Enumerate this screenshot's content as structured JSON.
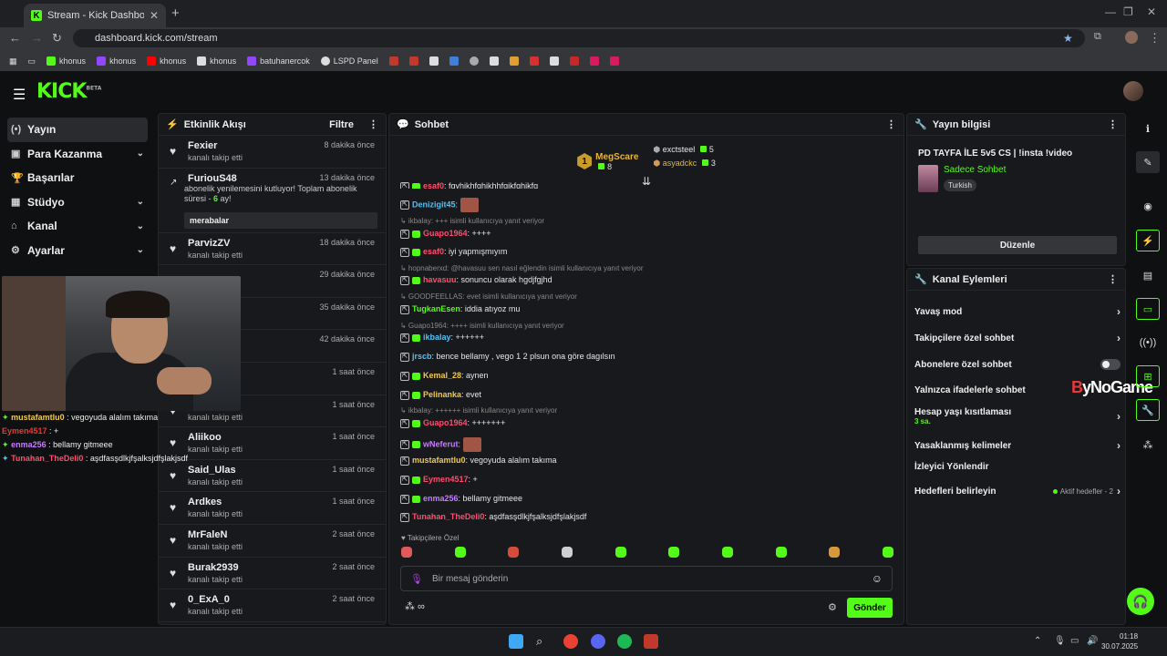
{
  "browser": {
    "tab_title": "Stream - Kick Dashboard",
    "url": "dashboard.kick.com/stream",
    "bookmarks": [
      {
        "label": "khonus",
        "color": "#53fc18"
      },
      {
        "label": "khonus",
        "color": "#9146ff"
      },
      {
        "label": "khonus",
        "color": "#ff0000"
      },
      {
        "label": "khonus",
        "color": "#dddddd"
      },
      {
        "label": "batuhanercok",
        "color": "#9146ff"
      },
      {
        "label": "LSPD Panel",
        "color": "#dddddd"
      }
    ]
  },
  "header": {
    "logo": "KICK",
    "logo_tag": "BETA"
  },
  "sidebar": {
    "items": [
      {
        "icon": "stream-icon",
        "glyph": "(•)",
        "label": "Yayın",
        "chevron": false
      },
      {
        "icon": "money-icon",
        "glyph": "▣",
        "label": "Para Kazanma",
        "chevron": true
      },
      {
        "icon": "trophy-icon",
        "glyph": "🏆",
        "label": "Başarılar",
        "chevron": false
      },
      {
        "icon": "studio-icon",
        "glyph": "▦",
        "label": "Stüdyo",
        "chevron": true
      },
      {
        "icon": "channel-icon",
        "glyph": "⌂",
        "label": "Kanal",
        "chevron": true
      },
      {
        "icon": "settings-icon",
        "glyph": "⚙",
        "label": "Ayarlar",
        "chevron": true
      }
    ]
  },
  "events": {
    "title": "Etkinlik Akışı",
    "filter_label": "Filtre",
    "items": [
      {
        "name": "Fexier",
        "sub": "kanalı takip etti",
        "time": "8 dakika önce"
      },
      {
        "name": "FuriouS48",
        "sub": "",
        "time": "13 dakika önce"
      },
      {
        "name": "ParvizZV",
        "sub": "kanalı takip etti",
        "time": "18 dakika önce"
      },
      {
        "name": "",
        "sub": "",
        "time": "29 dakika önce"
      },
      {
        "name": "",
        "sub": "",
        "time": "35 dakika önce"
      },
      {
        "name": "",
        "sub": "",
        "time": "42 dakika önce"
      },
      {
        "name": "",
        "sub": "",
        "time": "1 saat önce"
      },
      {
        "name": "azrakkn",
        "sub": "kanalı takip etti",
        "time": "1 saat önce"
      },
      {
        "name": "Aliikoo",
        "sub": "kanalı takip etti",
        "time": "1 saat önce"
      },
      {
        "name": "Said_Ulas",
        "sub": "kanalı takip etti",
        "time": "1 saat önce"
      },
      {
        "name": "Ardkes",
        "sub": "kanalı takip etti",
        "time": "1 saat önce"
      },
      {
        "name": "MrFaleN",
        "sub": "kanalı takip etti",
        "time": "2 saat önce"
      },
      {
        "name": "Burak2939",
        "sub": "kanalı takip etti",
        "time": "2 saat önce"
      },
      {
        "name": "0_ExA_0",
        "sub": "kanalı takip etti",
        "time": "2 saat önce"
      }
    ],
    "sub_message_a": "abonelik yenilemesini kutluyor! Toplam abonelik süresi - ",
    "sub_months": "6",
    "sub_message_b": " ay!",
    "sub_note": "merabalar"
  },
  "overlay_chat": [
    {
      "user": "mustafamtlu0",
      "text": " : vegoyuda alalım takıma",
      "color": "#f2c94c",
      "badge": "#53fc18"
    },
    {
      "user": "Eymen4517",
      "text": " : +",
      "color": "#e53935",
      "badge": ""
    },
    {
      "user": "enma256",
      "text": " : bellamy gitmeee",
      "color": "#c77dff",
      "badge": "#53fc18"
    },
    {
      "user": "Tunahan_TheDeli0",
      "text": " : aşdfasşdlkjfşalksjdfşlakjsdf",
      "color": "#ff4d6d",
      "badge": "#4fc3f7"
    }
  ],
  "chat": {
    "title": "Sohbet",
    "leaderboard": {
      "first_rank": "1",
      "first_name": "MegScare",
      "first_count": "8",
      "second_name": "exctsteel",
      "second_count": "5",
      "third_name": "asyadckc",
      "third_count": "3"
    },
    "messages": [
      {
        "type": "reply",
        "text": "↳ ikbalay: +++ isimli kullanıcıya yanıt veriyor"
      },
      {
        "type": "msg",
        "user": "Guapo1964",
        "color": "#ff4d6d",
        "text": ": ++++"
      },
      {
        "type": "msg",
        "user": "esaf0",
        "color": "#ff4d6d",
        "text": ": iyi yapmışmıyım"
      },
      {
        "type": "reply",
        "text": "↳ hopnaberxd: @havasuu sen nasıl eğlendin isimli kullanıcıya yanıt veriyor"
      },
      {
        "type": "msg",
        "user": "havasuu",
        "color": "#ff4d6d",
        "text": ": sonuncu olarak hgdjfgjhd"
      },
      {
        "type": "reply",
        "text": "↳ GOODFEELLAS: evet isimli kullanıcıya yanıt veriyor"
      },
      {
        "type": "msg",
        "user": "TugkanEsen",
        "color": "#53fc18",
        "text": ": iddia atıyoz mu"
      },
      {
        "type": "reply",
        "text": "↳ Guapo1964: ++++ isimli kullanıcıya yanıt veriyor"
      },
      {
        "type": "msg",
        "user": "ikbalay",
        "color": "#4fc3f7",
        "text": ": ++++++"
      },
      {
        "type": "msg",
        "user": "jrscb",
        "color": "#4fc3f7",
        "text": ": bence bellamy , vego 1 2 plsun ona göre dagılsın"
      },
      {
        "type": "msg",
        "user": "Kemal_28",
        "color": "#f2c94c",
        "text": ": aynen"
      },
      {
        "type": "msg",
        "user": "Pelinanka",
        "color": "#f2c94c",
        "text": ": evet"
      },
      {
        "type": "reply",
        "text": "↳ ikbalay: ++++++ isimli kullanıcıya yanıt veriyor"
      },
      {
        "type": "msg",
        "user": "Guapo1964",
        "color": "#ff4d6d",
        "text": ": +++++++"
      },
      {
        "type": "msg",
        "user": "wNeferut",
        "color": "#c77dff",
        "text": ":"
      },
      {
        "type": "msg",
        "user": "mustafamtlu0",
        "color": "#f2c94c",
        "text": ": vegoyuda alalım takıma"
      },
      {
        "type": "msg",
        "user": "Eymen4517",
        "color": "#ff4d6d",
        "text": ": +"
      },
      {
        "type": "msg",
        "user": "enma256",
        "color": "#c77dff",
        "text": ": bellamy gitmeee"
      },
      {
        "type": "msg",
        "user": "Tunahan_TheDeli0",
        "color": "#ff4d6d",
        "text": ": aşdfasşdlkjfşalksjdfşlakjsdf"
      }
    ],
    "top_partial_user": "esaf0",
    "top_partial_text": ": fgyhjkhfghjkhhfgjkfghjkfg",
    "top_user2": "Denizigit45",
    "followers_only_label": "Takipçilere Özel",
    "input_placeholder": "Bir mesaj gönderin",
    "send_label": "Gönder"
  },
  "stream_info": {
    "title": "Yayın bilgisi",
    "stream_title": "PD TAYFA İLE 5v5 CS | !insta !video",
    "category": "Sadece Sohbet",
    "language_tag": "Turkish",
    "edit_label": "Düzenle"
  },
  "channel_actions": {
    "title": "Kanal Eylemleri",
    "slow_mode": "Yavaş mod",
    "followers_chat": "Takipçilere özel sohbet",
    "subs_chat": "Abonelere özel sohbet",
    "emote_chat": "Yalnızca ifadelerle sohbet",
    "account_age": "Hesap yaşı kısıtlaması",
    "account_age_value": "3 sa.",
    "banned_words": "Yasaklanmış kelimeler",
    "redirect": "İzleyici Yönlendir",
    "goals": "Hedefleri belirleyin",
    "goals_status": "Aktif hedefler - 2"
  },
  "watermark": {
    "a": "B",
    "b": "yNoGame"
  },
  "taskbar": {
    "time": "01:18",
    "date": "30.07.2025"
  },
  "colors": {
    "accent": "#53fc18",
    "panel": "#18191c",
    "bg": "#0f1012"
  }
}
